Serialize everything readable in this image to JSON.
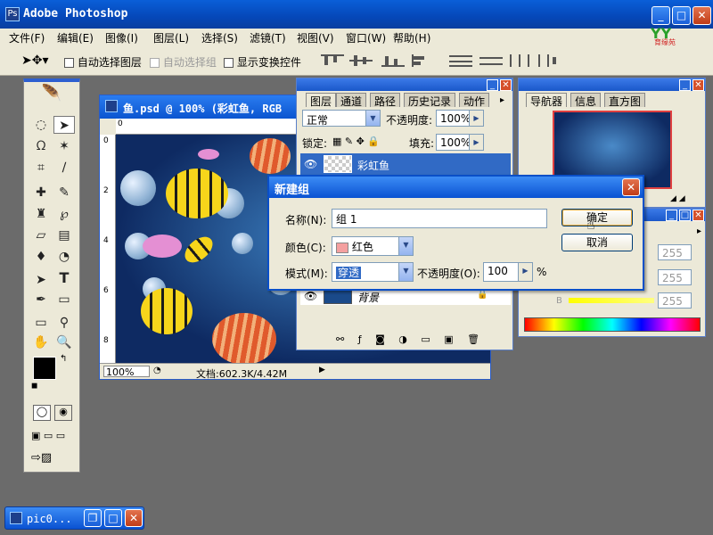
{
  "app": {
    "title": "Adobe Photoshop",
    "logo_text": "YY",
    "logo_caption": "育缘苑"
  },
  "menu": [
    "文件(F)",
    "编辑(E)",
    "图像(I)",
    "图层(L)",
    "选择(S)",
    "滤镜(T)",
    "视图(V)",
    "窗口(W)",
    "帮助(H)"
  ],
  "options": {
    "auto_select_layer": "自动选择图层",
    "auto_select_group": "自动选择组",
    "show_transform": "显示变换控件"
  },
  "document": {
    "title": "鱼.psd @ 100% (彩虹鱼, RGB",
    "zoom": "100%",
    "doc_info": "文档:602.3K/4.42M",
    "ruler_ticks": [
      "0",
      "2",
      "4",
      "6",
      "8"
    ],
    "ruler_h_ticks": [
      "0"
    ]
  },
  "layers_panel": {
    "tabs": [
      "图层",
      "通道",
      "路径",
      "历史记录",
      "动作"
    ],
    "blend_mode": "正常",
    "opacity_label": "不透明度:",
    "opacity_value": "100%",
    "lock_label": "锁定:",
    "fill_label": "填充:",
    "fill_value": "100%",
    "layers": [
      {
        "name": "彩虹鱼",
        "selected": true
      },
      {
        "name": "背景",
        "selected": false
      }
    ]
  },
  "navigator_panel": {
    "tabs": [
      "导航器",
      "信息",
      "直方图"
    ]
  },
  "color_panel": {
    "values": [
      "255",
      "255",
      "255"
    ],
    "b_label": "B"
  },
  "dialog": {
    "title": "新建组",
    "name_label": "名称(N):",
    "name_value": "组 1",
    "color_label": "颜色(C):",
    "color_value": "红色",
    "mode_label": "模式(M):",
    "mode_value": "穿透",
    "opacity_label": "不透明度(O):",
    "opacity_value": "100",
    "percent": "%",
    "ok_label": "确定",
    "cancel_label": "取消"
  },
  "taskbar": {
    "item_label": "pic0..."
  },
  "colors": {
    "accent": "#0a52d2",
    "chrome": "#ece9d8",
    "swatch_red": "#f4a0a0"
  }
}
